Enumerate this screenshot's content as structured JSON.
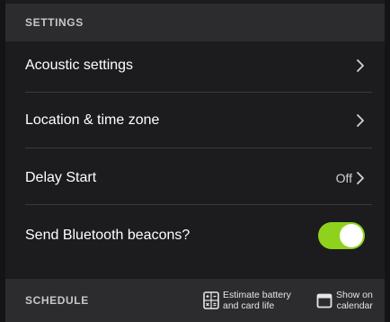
{
  "settings_header": "SETTINGS",
  "rows": [
    {
      "label": "Acoustic settings",
      "value": ""
    },
    {
      "label": "Location & time zone",
      "value": ""
    },
    {
      "label": "Delay Start",
      "value": "Off"
    },
    {
      "label": "Send Bluetooth beacons?",
      "toggle_on": true
    }
  ],
  "schedule_header": "SCHEDULE",
  "actions": {
    "battery": {
      "line1": "Estimate battery",
      "line2": "and card life",
      "icon": "battery-estimate-icon"
    },
    "calendar": {
      "line1": "Show on",
      "line2": "calendar",
      "icon": "calendar-icon"
    }
  },
  "colors": {
    "background": "#1c1c1e",
    "header": "#2c2c2e",
    "toggle_on": "#8fd21e"
  }
}
